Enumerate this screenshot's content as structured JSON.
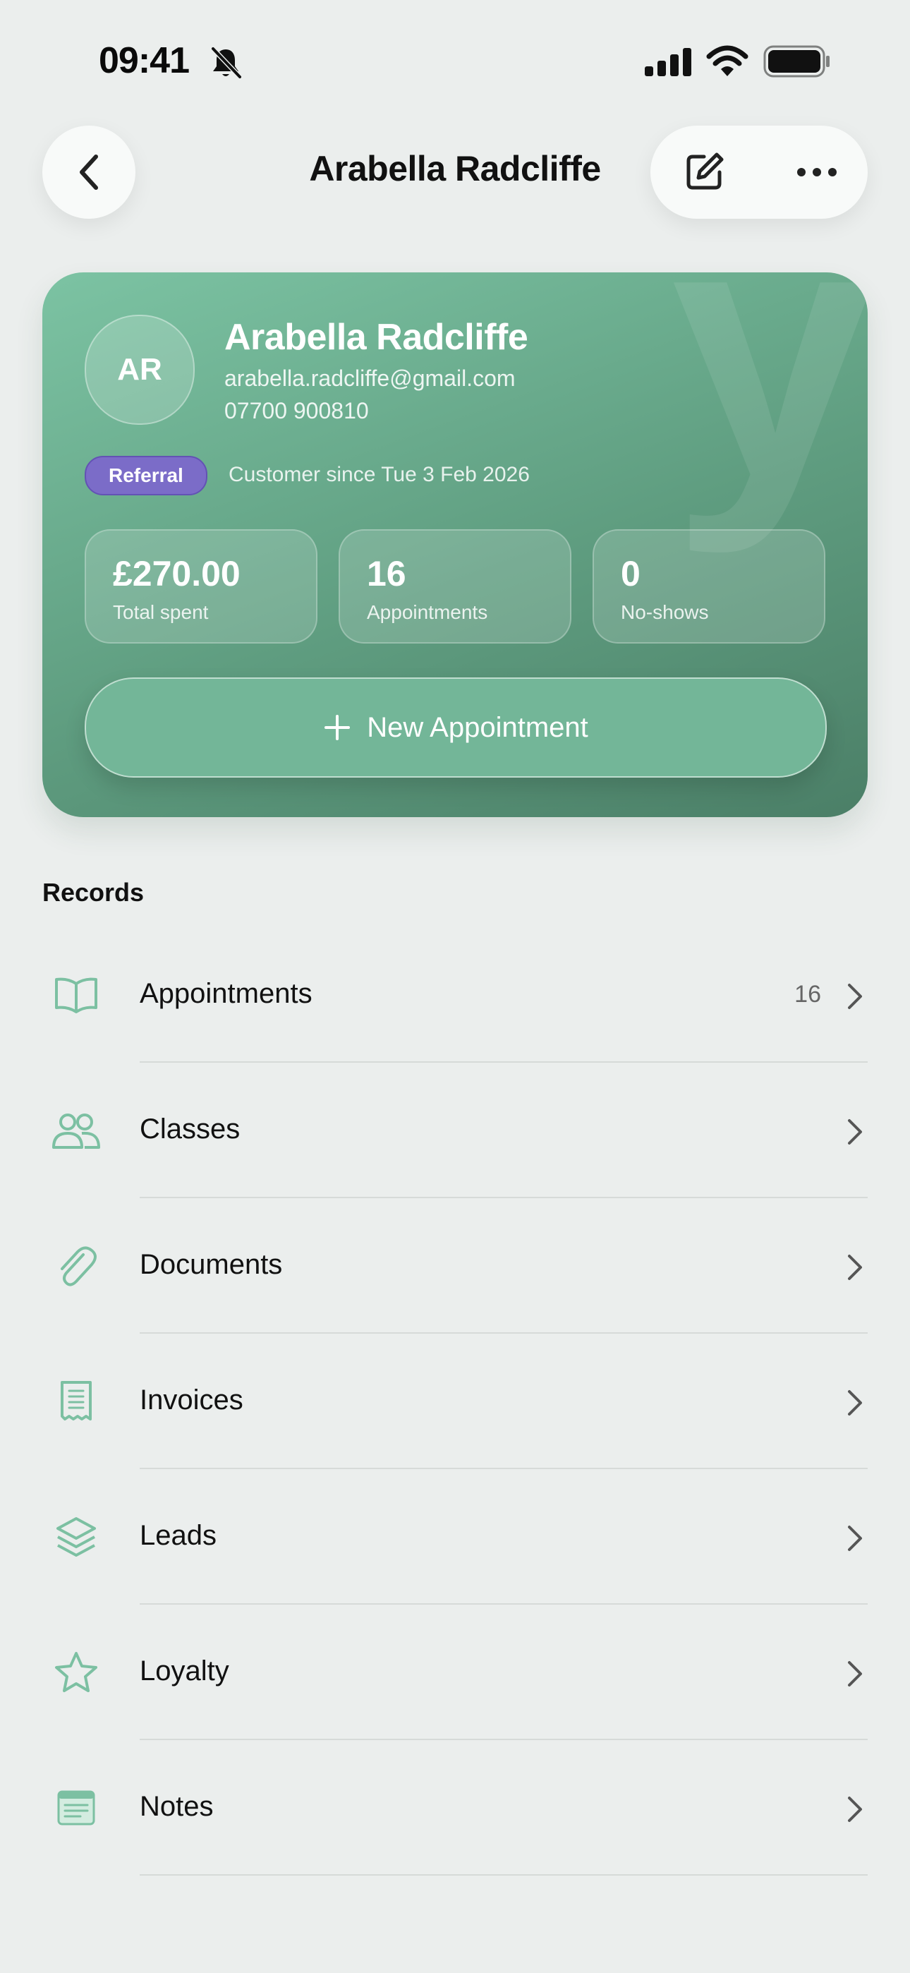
{
  "status_bar": {
    "time": "09:41"
  },
  "nav": {
    "title": "Arabella Radcliffe"
  },
  "profile": {
    "initials": "AR",
    "name": "Arabella Radcliffe",
    "email": "arabella.radcliffe@gmail.com",
    "phone": "07700 900810",
    "badge": "Referral",
    "customer_since": "Customer since Tue 3 Feb 2026",
    "watermark": "y",
    "stats": [
      {
        "value": "£270.00",
        "label": "Total spent"
      },
      {
        "value": "16",
        "label": "Appointments"
      },
      {
        "value": "0",
        "label": "No-shows"
      }
    ],
    "new_appointment_label": "New Appointment"
  },
  "records": {
    "title": "Records",
    "items": [
      {
        "label": "Appointments",
        "count": "16",
        "icon": "book-icon"
      },
      {
        "label": "Classes",
        "count": "",
        "icon": "people-icon"
      },
      {
        "label": "Documents",
        "count": "",
        "icon": "paperclip-icon"
      },
      {
        "label": "Invoices",
        "count": "",
        "icon": "receipt-icon"
      },
      {
        "label": "Leads",
        "count": "",
        "icon": "layers-icon"
      },
      {
        "label": "Loyalty",
        "count": "",
        "icon": "star-icon"
      },
      {
        "label": "Notes",
        "count": "",
        "icon": "note-icon"
      }
    ]
  },
  "colors": {
    "accent": "#73b698",
    "card_gradient_start": "#7cc3a3",
    "card_gradient_end": "#4b7f67",
    "badge": "#7b6cc8",
    "background": "#ebeeed"
  }
}
